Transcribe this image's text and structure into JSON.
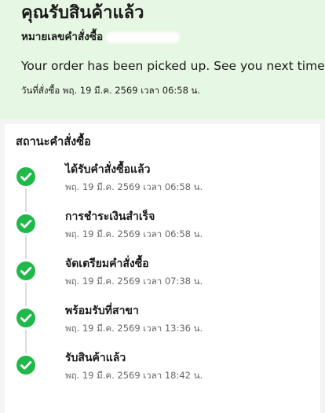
{
  "header": {
    "title": "คุณรับสินค้าแล้ว",
    "order_number_label": "หมายเลขคำสั่งซื้อ",
    "message": "Your order has been picked up. See you next time!",
    "order_date": "วันที่สั่งซื้อ พฤ. 19 มี.ค. 2569 เวลา 06:58 น."
  },
  "status": {
    "title": "สถานะคำสั่งซื้อ",
    "steps": [
      {
        "label": "ได้รับคำสั่งซื้อแล้ว",
        "time": "พฤ. 19 มี.ค. 2569 เวลา 06:58 น.",
        "icon": "check-circle-icon"
      },
      {
        "label": "การชำระเงินสำเร็จ",
        "time": "พฤ. 19 มี.ค. 2569 เวลา 06:58 น.",
        "icon": "check-circle-icon"
      },
      {
        "label": "จัดเตรียมคำสั่งซื้อ",
        "time": "พฤ. 19 มี.ค. 2569 เวลา 07:38 น.",
        "icon": "check-circle-icon"
      },
      {
        "label": "พร้อมรับที่สาขา",
        "time": "พฤ. 19 มี.ค. 2569 เวลา 13:36 น.",
        "icon": "check-circle-icon"
      },
      {
        "label": "รับสินค้าแล้ว",
        "time": "พฤ. 19 มี.ค. 2569 เวลา 18:42 น.",
        "icon": "check-circle-icon"
      }
    ]
  },
  "colors": {
    "header_background": "#e6f7e3",
    "success_green": "#21b84a",
    "timeline_line": "#dcdcdc"
  }
}
